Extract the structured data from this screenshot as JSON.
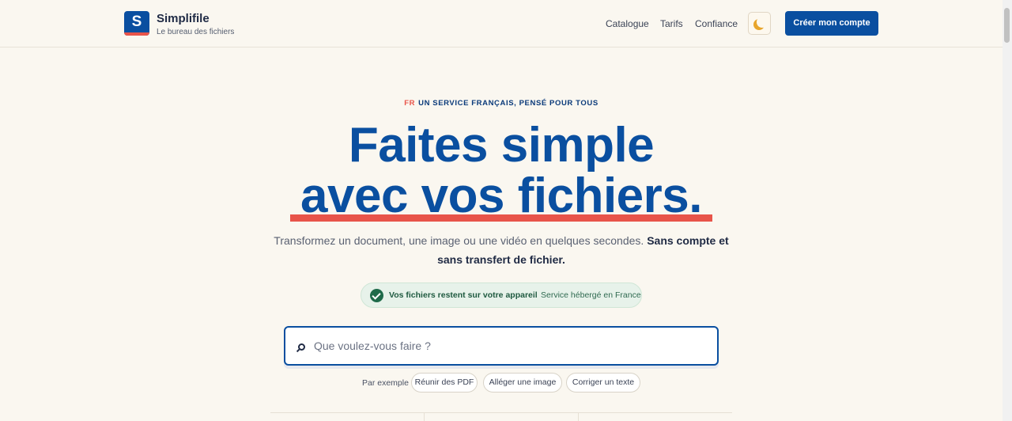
{
  "header": {
    "logo_letter": "S",
    "brand_name": "Simplifile",
    "brand_tagline": "Le bureau des fichiers",
    "nav": [
      "Catalogue",
      "Tarifs",
      "Confiance"
    ],
    "theme_toggle_icon": "moon-icon",
    "cta_label": "Créer mon compte"
  },
  "hero": {
    "eyebrow_flag": "FR",
    "eyebrow_text": "UN SERVICE FRANÇAIS, PENSÉ POUR TOUS",
    "title_line1": "Faites simple",
    "title_line2": "avec vos fichiers.",
    "subtitle_plain": "Transformez un document, une image ou une vidéo en quelques secondes.",
    "subtitle_bold": "Sans compte et sans transfert de fichier.",
    "trust_main": "Vos fichiers restent sur votre appareil",
    "trust_separator": "·",
    "trust_sub": "Service hébergé en France"
  },
  "search": {
    "placeholder": "Que voulez-vous faire ?",
    "value": "",
    "examples_label": "Par exemple",
    "examples": [
      "Réunir des PDF",
      "Alléger une image",
      "Corriger un texte"
    ]
  },
  "colors": {
    "brand_blue": "#0a4fa0",
    "accent_red": "#e8544a",
    "background": "#faf7f0",
    "trust_green": "#1f6b4a"
  }
}
